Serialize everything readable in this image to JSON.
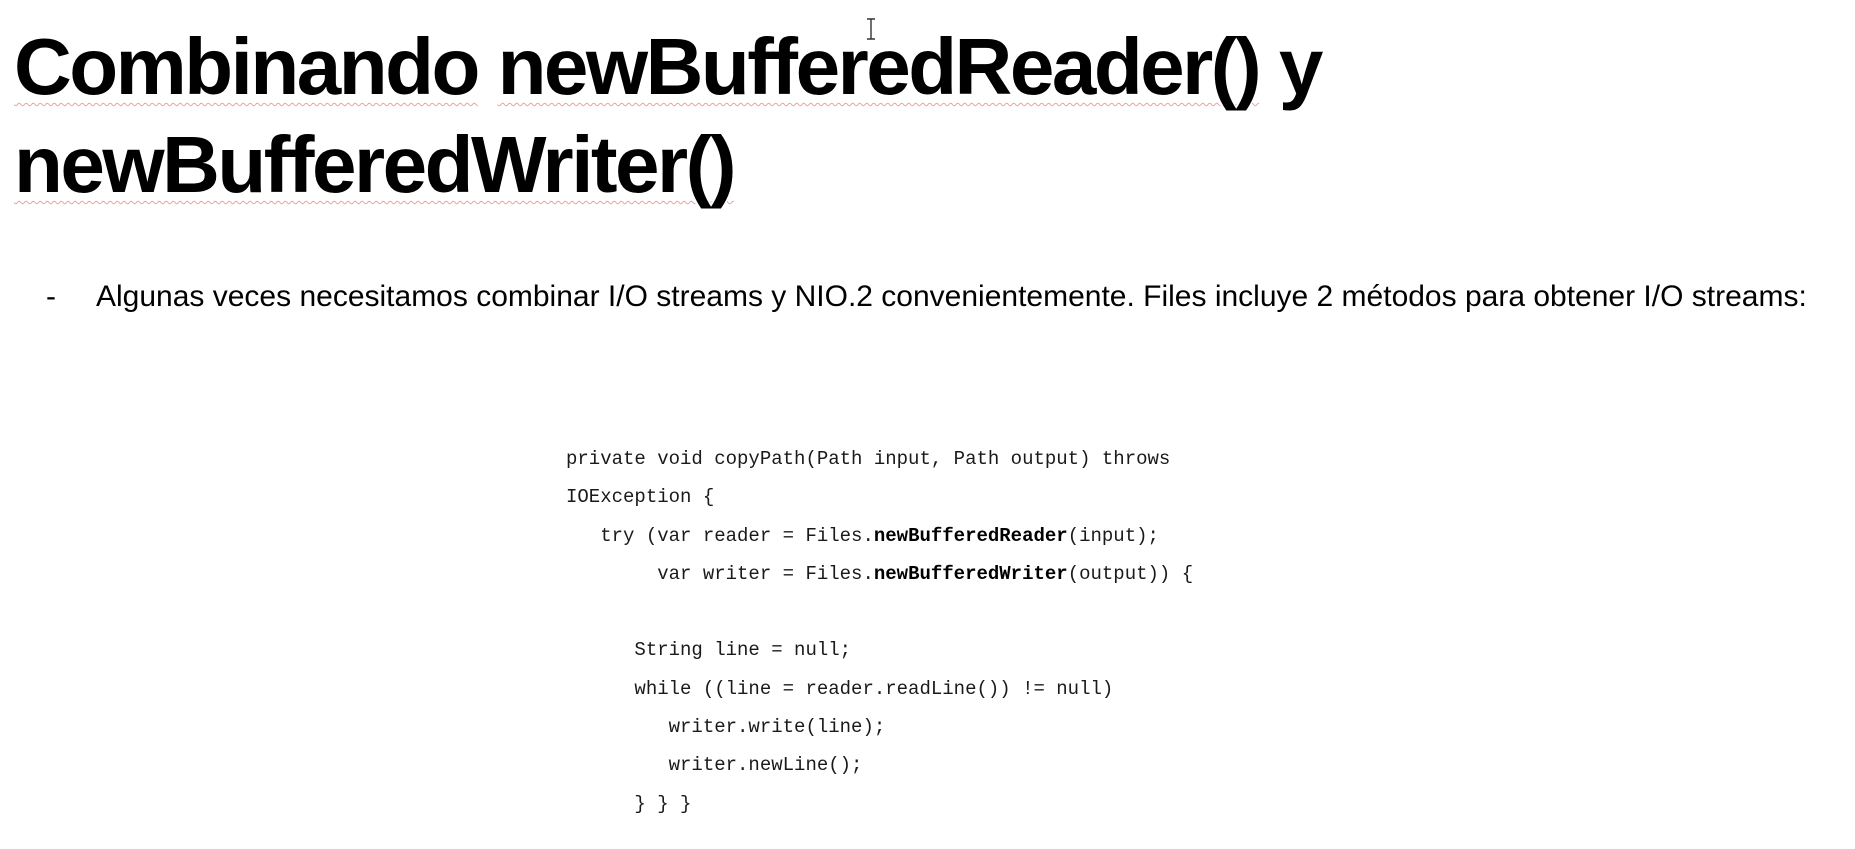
{
  "slide": {
    "title": {
      "line1_word1": "Combinando",
      "line1_word2": "newBufferedReader()",
      "line1_word3": "y",
      "line2_word1": "newBufferedWriter()"
    },
    "bullet": {
      "marker": "-",
      "text": "Algunas veces necesitamos combinar I/O streams y NIO.2 convenientemente. Files incluye 2 métodos para obtener I/O streams:"
    },
    "code": {
      "l1": "private void copyPath(Path input, Path output) throws",
      "l2": "IOException {",
      "l3_pre": "   try (var reader = Files.",
      "l3_bold": "newBufferedReader",
      "l3_post": "(input);",
      "l4_pre": "        var writer = Files.",
      "l4_bold": "newBufferedWriter",
      "l4_post": "(output)) {",
      "l5": "",
      "l6": "      String line = null;",
      "l7": "      while ((line = reader.readLine()) != null)",
      "l8": "         writer.write(line);",
      "l9": "         writer.newLine();",
      "l10": "      } } }"
    },
    "colors": {
      "spellcheck_underline": "#e8a1a1",
      "text": "#000000",
      "background": "#ffffff"
    },
    "icons": {
      "cursor": "text-cursor-icon"
    }
  }
}
